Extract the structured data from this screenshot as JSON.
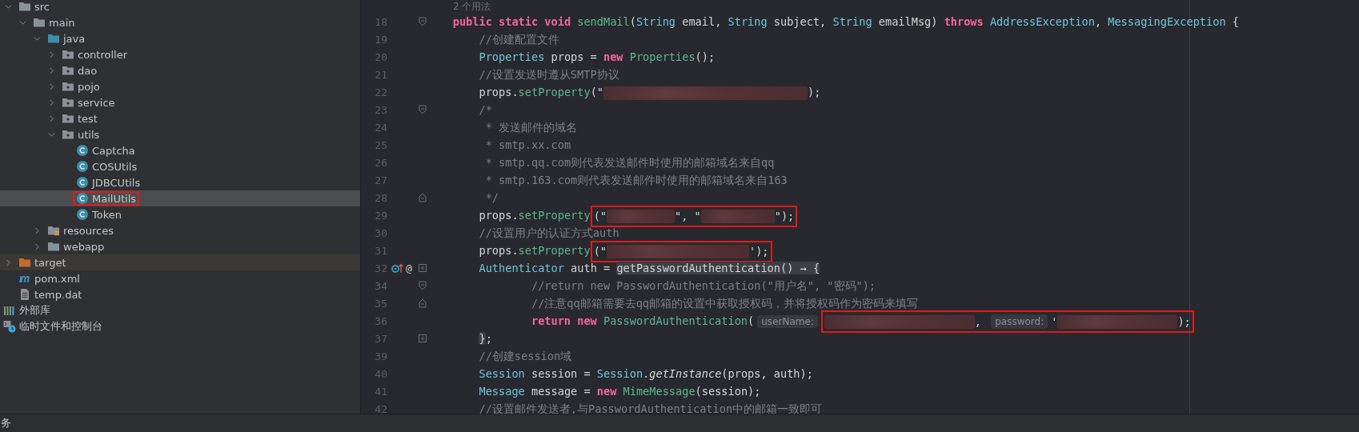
{
  "project_tree": {
    "items": [
      {
        "label": "src",
        "kind": "folder",
        "expanded": true,
        "selected": false,
        "hovered": false,
        "annotated": false,
        "children": [
          {
            "label": "main",
            "kind": "folder",
            "expanded": true,
            "selected": false,
            "hovered": false,
            "annotated": false,
            "children": [
              {
                "label": "java",
                "kind": "source-folder",
                "expanded": true,
                "selected": false,
                "hovered": false,
                "annotated": false,
                "children": [
                  {
                    "label": "controller",
                    "kind": "package",
                    "expanded": false,
                    "selected": false,
                    "hovered": false,
                    "annotated": false
                  },
                  {
                    "label": "dao",
                    "kind": "package",
                    "expanded": false,
                    "selected": false,
                    "hovered": false,
                    "annotated": false
                  },
                  {
                    "label": "pojo",
                    "kind": "package",
                    "expanded": false,
                    "selected": false,
                    "hovered": false,
                    "annotated": false
                  },
                  {
                    "label": "service",
                    "kind": "package",
                    "expanded": false,
                    "selected": false,
                    "hovered": false,
                    "annotated": false
                  },
                  {
                    "label": "test",
                    "kind": "package",
                    "expanded": false,
                    "selected": false,
                    "hovered": false,
                    "annotated": false
                  },
                  {
                    "label": "utils",
                    "kind": "package",
                    "expanded": true,
                    "selected": false,
                    "hovered": false,
                    "annotated": false,
                    "children": [
                      {
                        "label": "Captcha",
                        "kind": "class",
                        "selected": false,
                        "hovered": false,
                        "annotated": false
                      },
                      {
                        "label": "COSUtils",
                        "kind": "class",
                        "selected": false,
                        "hovered": false,
                        "annotated": false
                      },
                      {
                        "label": "JDBCUtils",
                        "kind": "class",
                        "selected": false,
                        "hovered": false,
                        "annotated": false
                      },
                      {
                        "label": "MailUtils",
                        "kind": "class",
                        "selected": true,
                        "hovered": false,
                        "annotated": true
                      },
                      {
                        "label": "Token",
                        "kind": "class",
                        "selected": false,
                        "hovered": false,
                        "annotated": false
                      }
                    ]
                  }
                ]
              },
              {
                "label": "resources",
                "kind": "resources-folder",
                "expanded": false,
                "selected": false,
                "hovered": false,
                "annotated": false
              },
              {
                "label": "webapp",
                "kind": "web-folder",
                "expanded": false,
                "selected": false,
                "hovered": false,
                "annotated": false
              }
            ]
          }
        ]
      },
      {
        "label": "target",
        "kind": "excluded-folder",
        "expanded": false,
        "selected": false,
        "hovered": true,
        "annotated": false
      },
      {
        "label": "pom.xml",
        "kind": "maven",
        "selected": false,
        "hovered": false,
        "annotated": false
      },
      {
        "label": "temp.dat",
        "kind": "file",
        "selected": false,
        "hovered": false,
        "annotated": false
      },
      {
        "label": "外部库",
        "kind": "library",
        "selected": false,
        "hovered": false,
        "annotated": false
      },
      {
        "label": "临时文件和控制台",
        "kind": "scratch",
        "selected": false,
        "hovered": false,
        "annotated": false
      }
    ]
  },
  "editor": {
    "lines": [
      {
        "kind": "usages",
        "text": "2 个用法"
      },
      {
        "kind": "code",
        "number": "18",
        "fold": {
          "kind": "start"
        },
        "tokens": [
          {
            "kind": "keyword",
            "text": "    public static void "
          },
          {
            "kind": "method",
            "text": "sendMail"
          },
          {
            "kind": "plain",
            "text": "("
          },
          {
            "kind": "type",
            "text": "String"
          },
          {
            "kind": "plain",
            "text": " email, "
          },
          {
            "kind": "type",
            "text": "String"
          },
          {
            "kind": "plain",
            "text": " subject, "
          },
          {
            "kind": "type",
            "text": "String"
          },
          {
            "kind": "plain",
            "text": " emailMsg) "
          },
          {
            "kind": "keyword",
            "text": "throws "
          },
          {
            "kind": "type",
            "text": "AddressException"
          },
          {
            "kind": "plain",
            "text": ", "
          },
          {
            "kind": "type",
            "text": "MessagingException"
          },
          {
            "kind": "plain",
            "text": " {"
          }
        ]
      },
      {
        "kind": "code",
        "number": "19",
        "tokens": [
          {
            "kind": "comment",
            "text": "        //创建配置文件"
          }
        ]
      },
      {
        "kind": "code",
        "number": "20",
        "tokens": [
          {
            "kind": "type",
            "text": "        Properties"
          },
          {
            "kind": "plain",
            "text": " props = "
          },
          {
            "kind": "keyword",
            "text": "new "
          },
          {
            "kind": "method",
            "text": "Properties"
          },
          {
            "kind": "plain",
            "text": "();"
          }
        ]
      },
      {
        "kind": "code",
        "number": "21",
        "tokens": [
          {
            "kind": "comment",
            "text": "        //设置发送时遵从SMTP协议"
          }
        ]
      },
      {
        "kind": "code",
        "number": "22",
        "tokens": [
          {
            "kind": "plain",
            "text": "        props."
          },
          {
            "kind": "method",
            "text": "setProperty"
          },
          {
            "kind": "plain",
            "text": "(\""
          },
          {
            "kind": "redacted"
          },
          {
            "kind": "plain",
            "text": ");"
          }
        ]
      },
      {
        "kind": "code",
        "number": "23",
        "fold": {
          "kind": "start"
        },
        "tokens": [
          {
            "kind": "comment",
            "text": "        /*"
          }
        ]
      },
      {
        "kind": "code",
        "number": "24",
        "tokens": [
          {
            "kind": "comment",
            "text": "         * 发送邮件的域名"
          }
        ]
      },
      {
        "kind": "code",
        "number": "25",
        "tokens": [
          {
            "kind": "comment",
            "text": "         * smtp.xx.com"
          }
        ]
      },
      {
        "kind": "code",
        "number": "26",
        "tokens": [
          {
            "kind": "comment",
            "text": "         * smtp.qq.com则代表发送邮件时使用的邮箱域名来自qq"
          }
        ]
      },
      {
        "kind": "code",
        "number": "27",
        "tokens": [
          {
            "kind": "comment",
            "text": "         * smtp.163.com则代表发送邮件时使用的邮箱域名来自163"
          }
        ]
      },
      {
        "kind": "code",
        "number": "28",
        "fold": {
          "kind": "end"
        },
        "tokens": [
          {
            "kind": "comment",
            "text": "         */"
          }
        ]
      },
      {
        "kind": "code",
        "number": "29",
        "tokens": [
          {
            "kind": "plain",
            "text": "        props."
          },
          {
            "kind": "method",
            "text": "setProperty"
          },
          {
            "kind": "boxed",
            "children": [
              {
                "kind": "plain",
                "text": "(\""
              },
              {
                "kind": "redacted"
              },
              {
                "kind": "plain",
                "text": "\", \""
              },
              {
                "kind": "redacted"
              },
              {
                "kind": "plain",
                "text": "\");"
              }
            ]
          }
        ]
      },
      {
        "kind": "code",
        "number": "30",
        "tokens": [
          {
            "kind": "comment",
            "text": "        //设置用户的认证方式auth"
          }
        ]
      },
      {
        "kind": "code",
        "number": "31",
        "tokens": [
          {
            "kind": "plain",
            "text": "        props."
          },
          {
            "kind": "method",
            "text": "setProperty"
          },
          {
            "kind": "boxed",
            "children": [
              {
                "kind": "plain",
                "text": "(\""
              },
              {
                "kind": "redacted"
              },
              {
                "kind": "plain",
                "text": "');"
              }
            ]
          }
        ]
      },
      {
        "kind": "code",
        "number": "32",
        "fold": {
          "kind": "collapsed"
        },
        "gutter": [
          {
            "kind": "override"
          },
          {
            "kind": "annotation",
            "text": "@"
          }
        ],
        "tokens": [
          {
            "kind": "type",
            "text": "        Authenticator"
          },
          {
            "kind": "plain",
            "text": " auth = "
          },
          {
            "kind": "folded",
            "text": "getPasswordAuthentication() → {"
          }
        ]
      },
      {
        "kind": "code",
        "number": "34",
        "fold": {
          "kind": "start"
        },
        "tokens": [
          {
            "kind": "comment",
            "text": "                //return new PasswordAuthentication(\"用户名\", \"密码\");"
          }
        ]
      },
      {
        "kind": "code",
        "number": "35",
        "fold": {
          "kind": "end"
        },
        "tokens": [
          {
            "kind": "comment",
            "text": "                //注意qq邮箱需要去qq邮箱的设置中获取授权码，并将授权码作为密码来填写"
          }
        ]
      },
      {
        "kind": "code",
        "number": "36",
        "tokens": [
          {
            "kind": "keyword",
            "text": "                return new "
          },
          {
            "kind": "method",
            "text": "PasswordAuthentication"
          },
          {
            "kind": "plain",
            "text": "("
          },
          {
            "kind": "hint",
            "text": "userName:"
          },
          {
            "kind": "boxed",
            "children": [
              {
                "kind": "redacted"
              },
              {
                "kind": "plain",
                "text": ", "
              },
              {
                "kind": "hint",
                "text": "password:"
              },
              {
                "kind": "plain",
                "text": "'"
              },
              {
                "kind": "redacted"
              },
              {
                "kind": "plain",
                "text": ");"
              }
            ]
          }
        ]
      },
      {
        "kind": "code",
        "number": "37",
        "fold": {
          "kind": "collapsed"
        },
        "tokens": [
          {
            "kind": "folded",
            "text": "        }"
          },
          {
            "kind": "plain",
            "text": ";"
          }
        ]
      },
      {
        "kind": "code",
        "number": "39",
        "tokens": [
          {
            "kind": "comment",
            "text": "        //创建session域"
          }
        ]
      },
      {
        "kind": "code",
        "number": "40",
        "tokens": [
          {
            "kind": "type",
            "text": "        Session"
          },
          {
            "kind": "plain",
            "text": " session = "
          },
          {
            "kind": "type",
            "text": "Session"
          },
          {
            "kind": "plain",
            "text": "."
          },
          {
            "kind": "italic",
            "text": "getInstance"
          },
          {
            "kind": "plain",
            "text": "(props, auth);"
          }
        ]
      },
      {
        "kind": "code",
        "number": "41",
        "tokens": [
          {
            "kind": "type",
            "text": "        Message"
          },
          {
            "kind": "plain",
            "text": " message = "
          },
          {
            "kind": "keyword",
            "text": "new "
          },
          {
            "kind": "method",
            "text": "MimeMessage"
          },
          {
            "kind": "plain",
            "text": "(session);"
          }
        ]
      },
      {
        "kind": "code",
        "number": "42",
        "tokens": [
          {
            "kind": "comment",
            "text": "        //设置邮件发送者,与PasswordAuthentication中的邮箱一致即可"
          }
        ]
      }
    ]
  },
  "status_bar": {
    "text": "务"
  }
}
